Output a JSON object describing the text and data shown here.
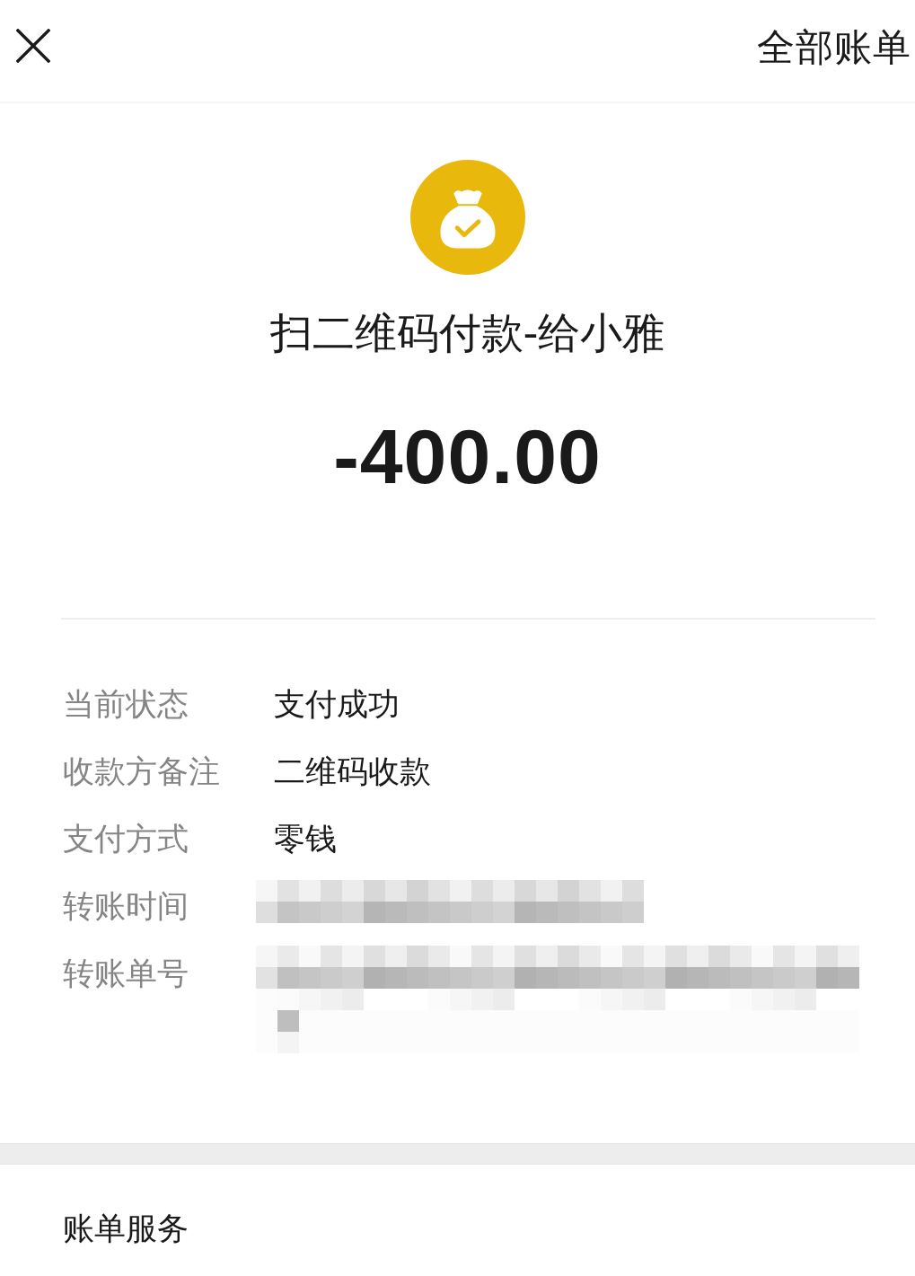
{
  "header": {
    "link": "全部账单"
  },
  "payment": {
    "title": "扫二维码付款-给小雅",
    "amount": "-400.00"
  },
  "details": [
    {
      "label": "当前状态",
      "value": "支付成功",
      "redacted": false
    },
    {
      "label": "收款方备注",
      "value": "二维码收款",
      "redacted": false
    },
    {
      "label": "支付方式",
      "value": "零钱",
      "redacted": false
    },
    {
      "label": "转账时间",
      "redacted": true
    },
    {
      "label": "转账单号",
      "redacted": true
    }
  ],
  "services": [
    {
      "label": "账单服务"
    }
  ]
}
